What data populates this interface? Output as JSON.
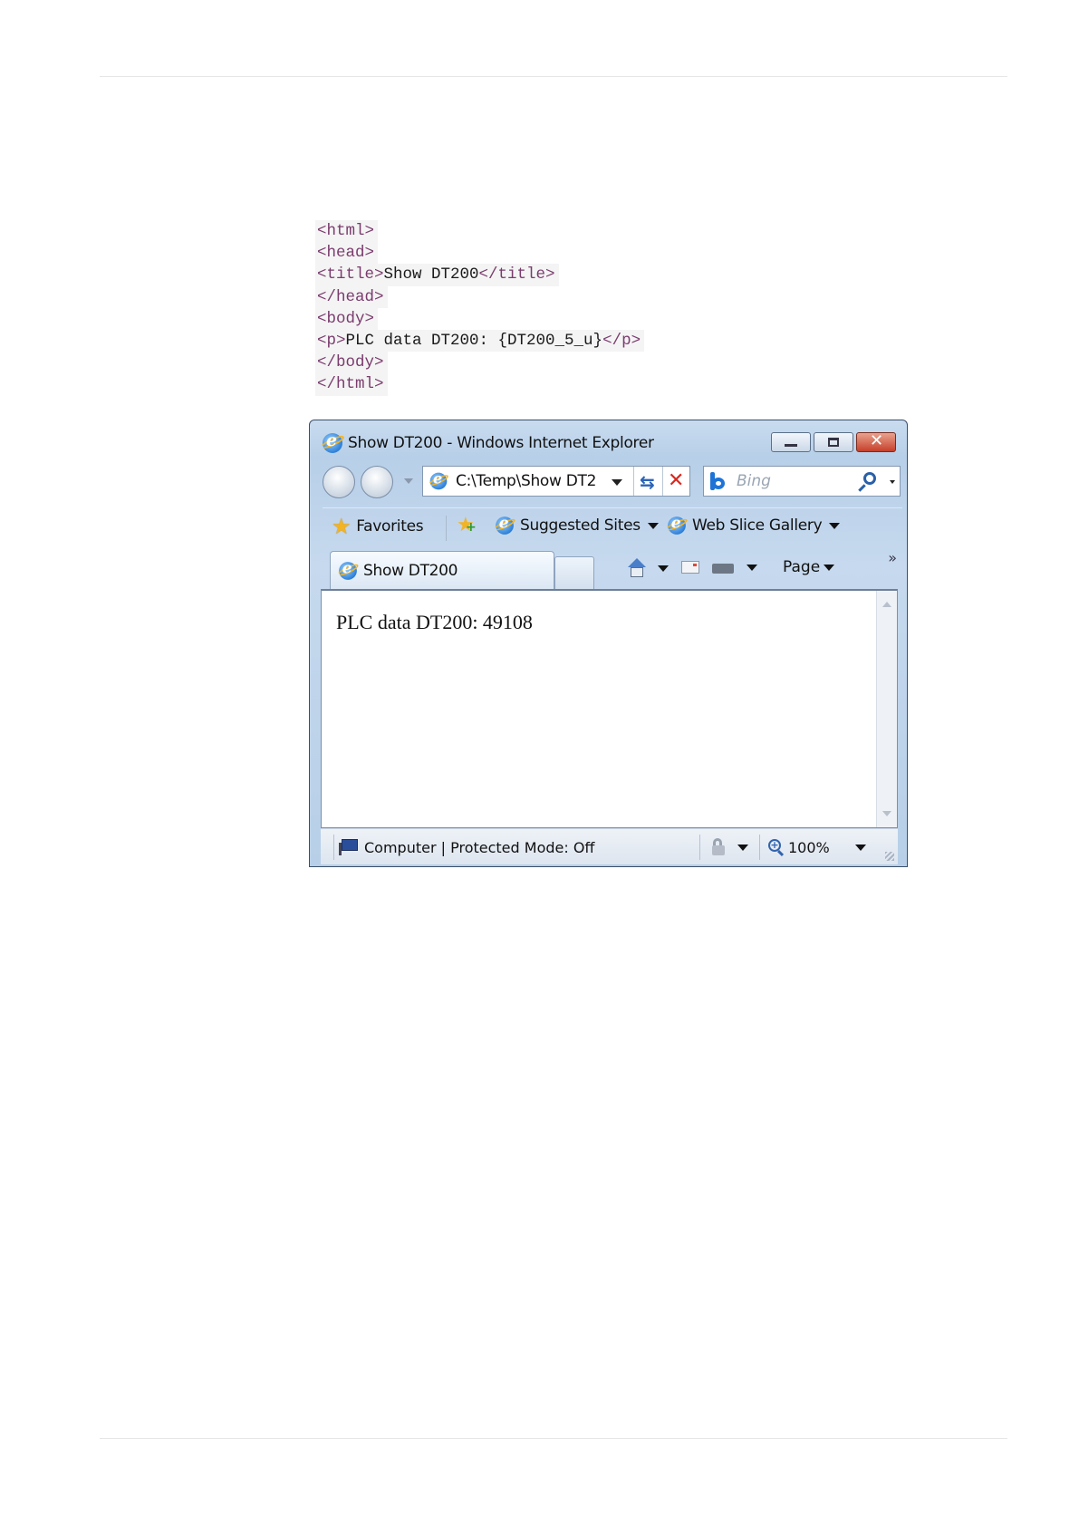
{
  "code_listing": {
    "lines": [
      {
        "tag_open": "<html>",
        "text": "",
        "tag_close": ""
      },
      {
        "tag_open": "<head>",
        "text": "",
        "tag_close": ""
      },
      {
        "tag_open": "<title>",
        "text": "Show DT200",
        "tag_close": "</title>"
      },
      {
        "tag_open": "</head>",
        "text": "",
        "tag_close": ""
      },
      {
        "tag_open": "<body>",
        "text": "",
        "tag_close": ""
      },
      {
        "tag_open": "<p>",
        "text": "PLC data DT200: {DT200_5_u}",
        "tag_close": "</p>"
      },
      {
        "tag_open": "</body>",
        "text": "",
        "tag_close": ""
      },
      {
        "tag_open": "</html>",
        "text": "",
        "tag_close": ""
      }
    ]
  },
  "browser": {
    "window_title": "Show DT200 - Windows Internet Explorer",
    "address": "C:\\Temp\\Show DT2",
    "search_placeholder": "Bing",
    "favorites": {
      "favorites_label": "Favorites",
      "suggested_sites_label": "Suggested Sites",
      "web_slice_gallery_label": "Web Slice Gallery"
    },
    "tab_title": "Show DT200",
    "page_menu_label": "Page",
    "overflow_label": "»",
    "page_content": "PLC data DT200: 49108",
    "status": {
      "zone_text": "Computer | Protected Mode: Off",
      "zoom": "100%"
    }
  }
}
